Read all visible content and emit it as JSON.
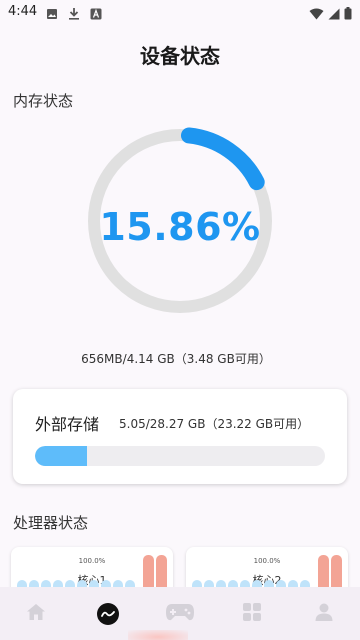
{
  "status_bar": {
    "time": "4:44",
    "left_icons": [
      "image-icon",
      "download-icon",
      "a-icon"
    ],
    "right_icons": [
      "wifi-icon",
      "signal-icon",
      "battery-icon"
    ]
  },
  "page": {
    "title": "设备状态"
  },
  "memory": {
    "section_title": "内存状态",
    "percent_text": "15.86%",
    "percent": 15.86,
    "detail": "656MB/4.14 GB（3.48 GB可用）",
    "accent": "#1e96f0",
    "track_color": "#e0e0e0"
  },
  "storage": {
    "label": "外部存储",
    "value": "5.05/28.27 GB（23.22 GB可用）",
    "used_fraction": 0.179,
    "fill_color": "#5ebcfa"
  },
  "cpu": {
    "section_title": "处理器状态",
    "cores": [
      {
        "percent": "100.0%",
        "name": "核心1"
      },
      {
        "percent": "100.0%",
        "name": "核心2"
      }
    ]
  },
  "bottom_nav": {
    "items": [
      {
        "icon": "home-icon",
        "active": false
      },
      {
        "icon": "monitor-icon",
        "active": true
      },
      {
        "icon": "gamepad-icon",
        "active": false
      },
      {
        "icon": "apps-grid-icon",
        "active": false
      },
      {
        "icon": "person-icon",
        "active": false
      }
    ]
  }
}
